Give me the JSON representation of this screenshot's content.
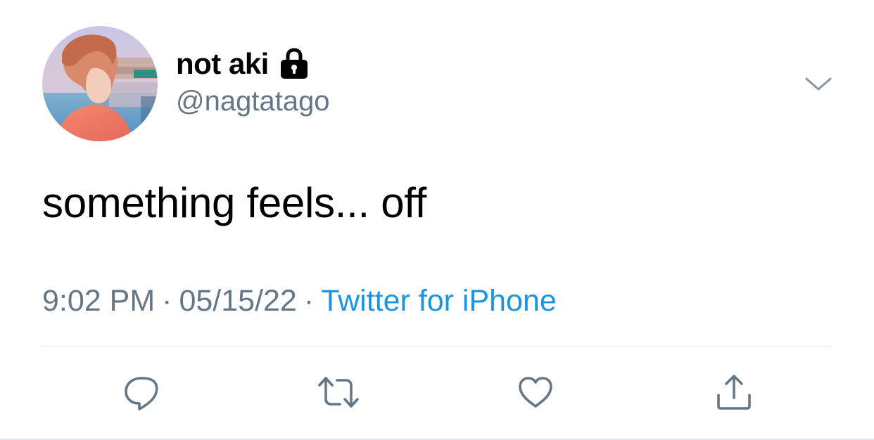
{
  "user": {
    "display_name": "not aki",
    "handle": "@nagtatago",
    "protected_icon": "lock-icon",
    "avatar_icon": "avatar"
  },
  "tweet": {
    "text": "something feels... off",
    "time": "9:02 PM",
    "separator": "·",
    "date": "05/15/22",
    "source": "Twitter for iPhone"
  },
  "menu": {
    "icon": "chevron-down-icon"
  },
  "actions": [
    {
      "name": "reply-button",
      "icon": "reply-icon"
    },
    {
      "name": "retweet-button",
      "icon": "retweet-icon"
    },
    {
      "name": "like-button",
      "icon": "heart-icon"
    },
    {
      "name": "share-button",
      "icon": "share-icon"
    }
  ],
  "colors": {
    "text_primary": "#000000",
    "text_secondary": "#657786",
    "link": "#1b95e0",
    "divider": "#e1e8ed",
    "icon": "#657786"
  }
}
